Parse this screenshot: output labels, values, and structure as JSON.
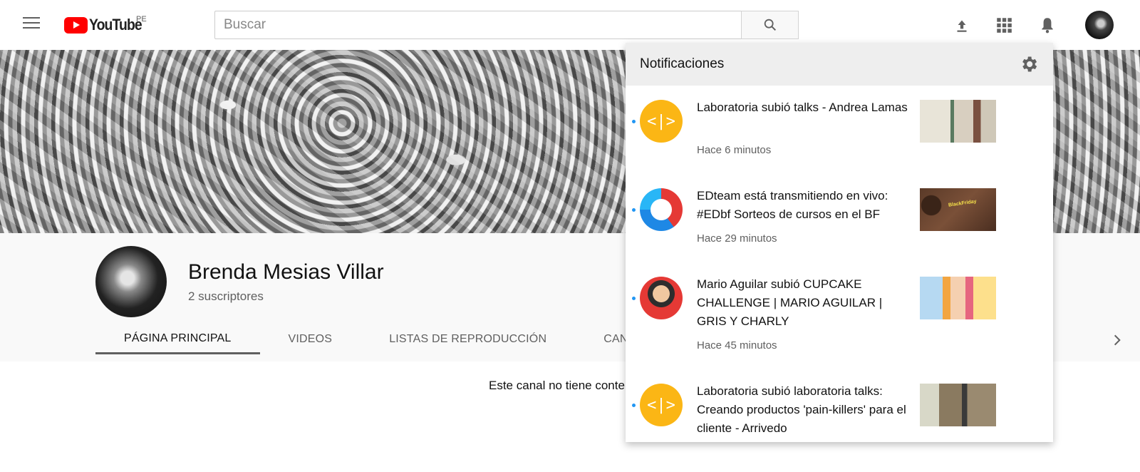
{
  "header": {
    "logo_text": "YouTube",
    "country": "PE",
    "search_placeholder": "Buscar",
    "icons": [
      "menu-icon",
      "search-icon",
      "upload-icon",
      "apps-icon",
      "bell-icon"
    ]
  },
  "channel": {
    "name": "Brenda Mesias Villar",
    "subscribers": "2 suscriptores",
    "tabs": [
      "PÁGINA PRINCIPAL",
      "VIDEOS",
      "LISTAS DE REPRODUCCIÓN",
      "CAN"
    ],
    "active_tab": "PÁGINA PRINCIPAL",
    "empty_message": "Este canal no tiene conte"
  },
  "notifications": {
    "title": "Notificaciones",
    "items": [
      {
        "avatar_text": "<|>",
        "text": "Laboratoria subió talks - Andrea Lamas",
        "time": "Hace 6 minutos"
      },
      {
        "avatar_text": "",
        "text": "EDteam está transmitiendo en vivo: #EDbf Sorteos de cursos en el BF",
        "time": "Hace 29 minutos",
        "thumb_text": "BlackFriday"
      },
      {
        "avatar_text": "",
        "text": "Mario Aguilar subió CUPCAKE CHALLENGE | MARIO AGUILAR | GRIS Y CHARLY",
        "time": "Hace 45 minutos"
      },
      {
        "avatar_text": "<|>",
        "text": "Laboratoria subió laboratoria talks: Creando productos 'pain-killers' para el cliente - Arrivedo",
        "time": ""
      }
    ]
  },
  "colors": {
    "brand_red": "#ff0000",
    "unread_dot": "#2196f3",
    "laboratoria": "#fbb615"
  }
}
